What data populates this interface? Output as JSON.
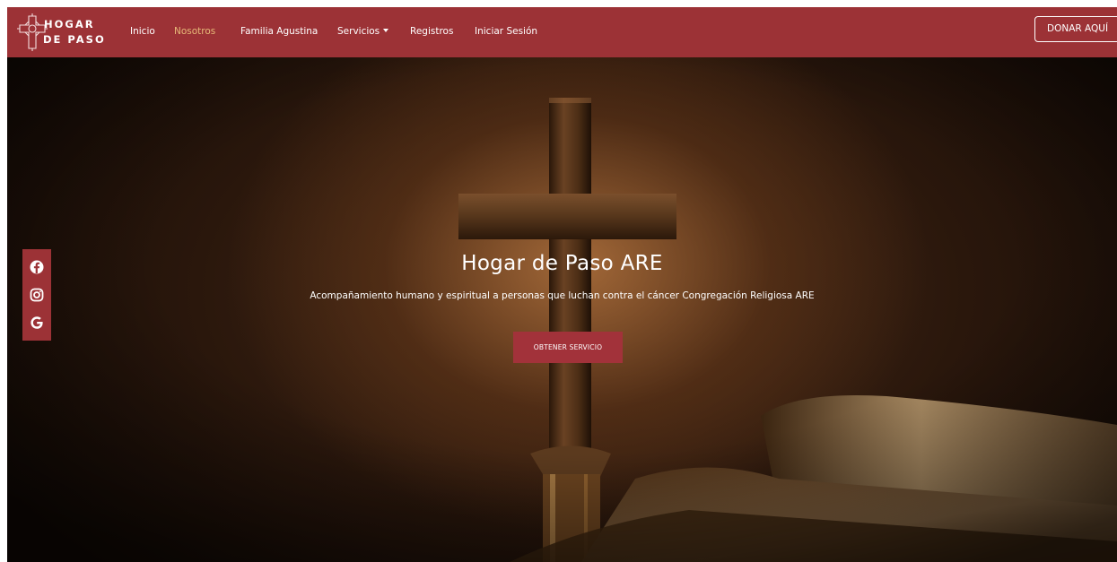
{
  "brand": {
    "line1": "HOGAR",
    "line2": "DE PASO",
    "emblem_icon": "cross-emblem-icon"
  },
  "nav": {
    "items": [
      {
        "label": "Inicio"
      },
      {
        "label": "Nosotros"
      },
      {
        "label": "Familia Agustina"
      },
      {
        "label": "Servicios"
      },
      {
        "label": "Registros"
      },
      {
        "label": "Iniciar Sesión"
      }
    ],
    "active": "Nosotros",
    "donate_label": "DONAR AQUÍ"
  },
  "social": {
    "icons": [
      "facebook-icon",
      "instagram-icon",
      "google-icon"
    ]
  },
  "hero": {
    "title": "Hogar de Paso ARE",
    "subtitle": "Acompañamiento humano y espiritual a personas que luchan contra el cáncer Congregación Religiosa ARE",
    "cta_label": "OBTENER SERVICIO"
  },
  "colors": {
    "brand": "#9c3236",
    "active_link": "#e6b978",
    "cta": "#a2323a"
  }
}
